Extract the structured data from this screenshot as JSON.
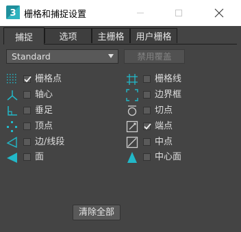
{
  "window": {
    "title": "栅格和捕捉设置",
    "app_icon_text": "3"
  },
  "tabs": [
    "捕捉",
    "选项",
    "主栅格",
    "用户栅格"
  ],
  "active_tab": "捕捉",
  "dropdown": {
    "value": "Standard"
  },
  "override_button": "禁用覆盖",
  "snaps_left": [
    {
      "label": "栅格点",
      "checked": true,
      "icon": "grid-points-icon"
    },
    {
      "label": "轴心",
      "checked": false,
      "icon": "pivot-icon"
    },
    {
      "label": "垂足",
      "checked": false,
      "icon": "perpendicular-icon"
    },
    {
      "label": "顶点",
      "checked": false,
      "icon": "vertex-icon"
    },
    {
      "label": "边/线段",
      "checked": false,
      "icon": "edge-segment-icon"
    },
    {
      "label": "面",
      "checked": false,
      "icon": "face-icon"
    }
  ],
  "snaps_right": [
    {
      "label": "栅格线",
      "checked": false,
      "icon": "grid-lines-icon"
    },
    {
      "label": "边界框",
      "checked": false,
      "icon": "bounding-box-icon"
    },
    {
      "label": "切点",
      "checked": false,
      "icon": "tangent-icon"
    },
    {
      "label": "端点",
      "checked": true,
      "icon": "endpoint-icon"
    },
    {
      "label": "中点",
      "checked": false,
      "icon": "midpoint-icon"
    },
    {
      "label": "中心面",
      "checked": false,
      "icon": "center-face-icon"
    }
  ],
  "clear_button": "清除全部",
  "colors": {
    "background": "#444444",
    "icon_cyan": "#22b8c8",
    "titlebar": "#ffffff"
  }
}
